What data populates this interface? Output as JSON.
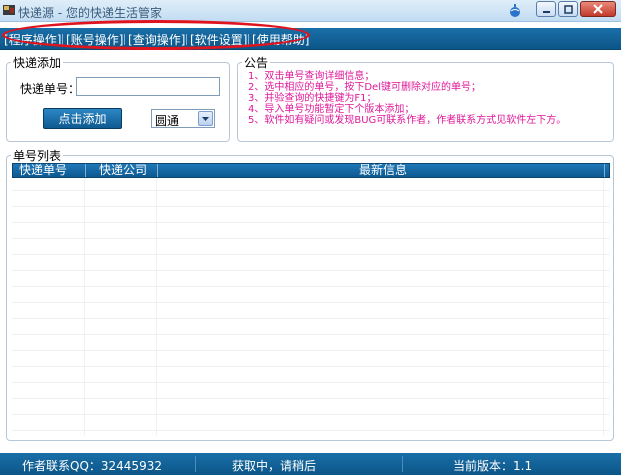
{
  "window": {
    "title": "快递源 - 您的快递生活管家",
    "icons": [
      "app-icon",
      "globe-icon",
      "minimize-icon",
      "restore-icon",
      "close-icon"
    ]
  },
  "menu": {
    "items": [
      {
        "label": "程序操作"
      },
      {
        "label": "账号操作"
      },
      {
        "label": "查询操作"
      },
      {
        "label": "软件设置"
      },
      {
        "label": "使用帮助"
      }
    ],
    "highlight_color": "#e0141e"
  },
  "quick_add": {
    "title": "快递添加",
    "number_label": "快递单号：",
    "number_value": "",
    "add_button": "点击添加",
    "company_selected": "圆通"
  },
  "notice": {
    "title": "公告",
    "lines": [
      "1、双击单号查询详细信息；",
      "2、选中相应的单号，按下Del键可删除对应的单号；",
      "3、并验查询的快捷键为F1；",
      "4、导入单号功能暂定下个版本添加；",
      "5、软件如有疑问或发现BUG可联系作者，作者联系方式见软件左下方。"
    ],
    "color": "#e0189a"
  },
  "list": {
    "title": "单号列表",
    "columns": [
      "快递单号",
      "快递公司",
      "最新信息"
    ],
    "rows": []
  },
  "status": {
    "author": "作者联系QQ：32445932",
    "state": "获取中，请稍后",
    "version": "当前版本：1.1"
  },
  "theme": {
    "accent": "#0c5688",
    "titlebar": "#c2dcf2"
  }
}
